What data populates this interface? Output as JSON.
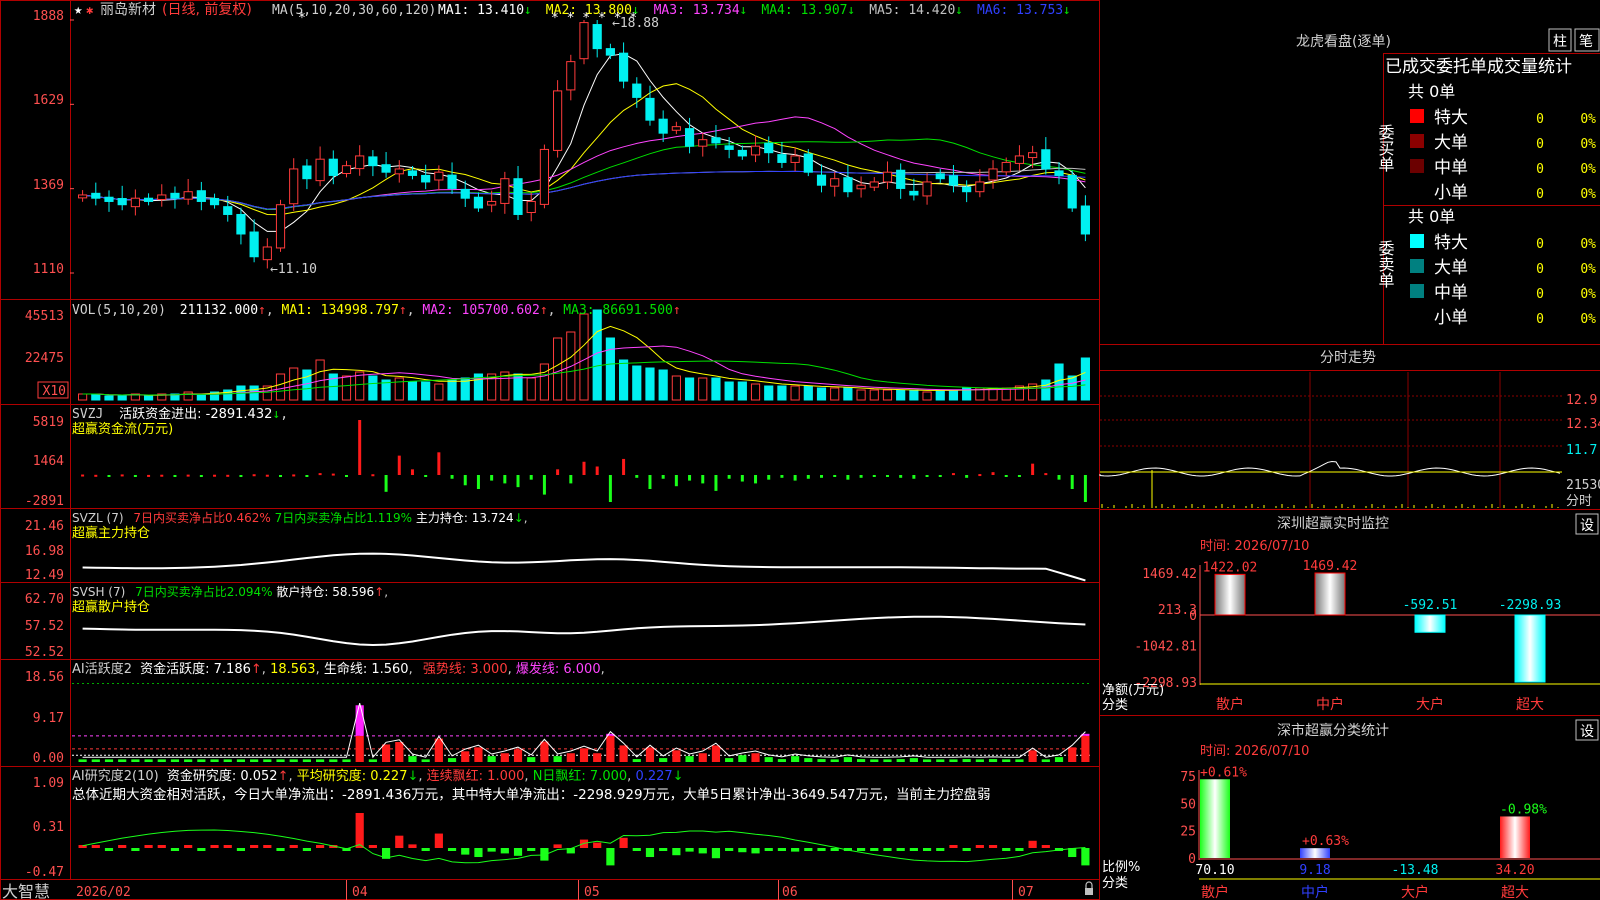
{
  "colors": {
    "up": "#ff3b3b",
    "down": "#00f0f0",
    "grid": "#8b0000",
    "axis": "#ff5050",
    "bg": "#000000",
    "white": "#ffffff",
    "yellow": "#ffff00",
    "magenta": "#ff44ff",
    "green": "#00e000",
    "blue": "#3040ff"
  },
  "header": {
    "stock": "丽岛新材",
    "mode": "(日线, 前复权)",
    "ma_spec": "MA(5,10,20,30,60,120)",
    "ma_items": [
      {
        "label": "MA1: 13.410",
        "color": "#ffffff"
      },
      {
        "label": "MA2: 13.800",
        "color": "#ffff00"
      },
      {
        "label": "MA3: 13.734",
        "color": "#ff44ff"
      },
      {
        "label": "MA4: 13.907",
        "color": "#00e000"
      },
      {
        "label": "MA5: 14.420",
        "color": "#c0c0c0"
      },
      {
        "label": "MA6: 13.753",
        "color": "#3040ff"
      }
    ]
  },
  "kline": {
    "y_ticks": [
      "1888",
      "1629",
      "1369",
      "1110"
    ],
    "high_label": "18.88",
    "low_label": "11.10"
  },
  "vol": {
    "title": "VOL(5,10,20)",
    "value": "211132.000",
    "ma1": "MA1: 134998.797",
    "ma2": "MA2: 105700.602",
    "ma3": "MA3: 86691.500",
    "y_ticks": [
      "45513",
      "22475"
    ],
    "unit": "X10"
  },
  "svzj": {
    "title": "SVZJ",
    "label": "活跃资金进出: -2891.432",
    "sub": "超赢资金流(万元)",
    "y_ticks": [
      "5819",
      "1464",
      "-2891"
    ]
  },
  "svzl": {
    "title": "SVZL (7)",
    "a": "7日内买卖净占比0.462%",
    "b": "7日内买卖净占比1.119%",
    "c": "主力持仓: 13.724",
    "sub": "超赢主力持仓",
    "y_ticks": [
      "21.46",
      "16.98",
      "12.49"
    ]
  },
  "svsh": {
    "title": "SVSH (7)",
    "a": "7日内买卖净占比2.094%",
    "b": "散户持仓: 58.596",
    "sub": "超赢散户持仓",
    "y_ticks": [
      "62.70",
      "57.52",
      "52.52"
    ]
  },
  "ai1": {
    "title": "AI活跃度2",
    "a": "资金活跃度: 7.186",
    "b": "18.563",
    "c": "生命线: 1.560",
    "d": "强势线: 3.000",
    "e": "爆发线: 6.000",
    "y_ticks": [
      "18.56",
      "9.17",
      "0.00"
    ]
  },
  "ai2": {
    "title": "AI研究度2(10)",
    "a": "资金研究度: 0.052",
    "b": "平均研究度: 0.227",
    "c": "连续飘红: 1.000",
    "d": "N日飘红: 7.000",
    "e": "0.227",
    "summary": "总体近期大资金相对活跃，今日大单净流出：-2891.436万元，其中特大单净流出：-2298.929万元，大单5日累计净出-3649.547万元，当前主力控盘弱",
    "y_ticks": [
      "1.09",
      "0.31",
      "-0.47"
    ]
  },
  "footer": {
    "brand": "大智慧",
    "dates": [
      "2026/02",
      "04",
      "05",
      "06",
      "07"
    ]
  },
  "dragon": {
    "title": "龙虎看盘(逐单)",
    "btn1": "柱",
    "btn2": "笔",
    "header": "已成交委托单成交量统计",
    "buy": {
      "side": "委买单",
      "total": "共 0单",
      "rows": [
        {
          "name": "特大",
          "v": "0",
          "p": "0%",
          "c": "#ff0000"
        },
        {
          "name": "大单",
          "v": "0",
          "p": "0%",
          "c": "#8b0000"
        },
        {
          "name": "中单",
          "v": "0",
          "p": "0%",
          "c": "#6b0000"
        },
        {
          "name": "小单",
          "v": "0",
          "p": "0%",
          "c": "#000000"
        }
      ]
    },
    "sell": {
      "side": "委卖单",
      "total": "共 0单",
      "rows": [
        {
          "name": "特大",
          "v": "0",
          "p": "0%",
          "c": "#00ffff"
        },
        {
          "name": "大单",
          "v": "0",
          "p": "0%",
          "c": "#008080"
        },
        {
          "name": "中单",
          "v": "0",
          "p": "0%",
          "c": "#008080"
        },
        {
          "name": "小单",
          "v": "0",
          "p": "0%",
          "c": "#000000"
        }
      ]
    }
  },
  "fenshi": {
    "title": "分时走势",
    "y_ticks": [
      "12.9",
      "12.34",
      "11.7",
      "21530",
      "分时"
    ]
  },
  "sz_monitor": {
    "title": "深圳超赢实时监控",
    "btn": "设",
    "time": "时间: 2026/07/10",
    "y_ticks": [
      "1469.42",
      "213.3",
      "0",
      "-1042.81",
      "-2298.93"
    ],
    "ylabel": "净额(万元)",
    "xlabel": "分类",
    "categories": [
      "散户",
      "中户",
      "大户",
      "超大"
    ],
    "values": [
      "1422.02",
      "1469.42",
      "-592.51",
      "-2298.93"
    ]
  },
  "sz_class": {
    "title": "深市超赢分类统计",
    "btn": "设",
    "time": "时间: 2026/07/10",
    "y_ticks": [
      "75",
      "50",
      "25",
      "0"
    ],
    "ylabel": "比例%",
    "xlabel": "分类",
    "categories": [
      "散户",
      "中户",
      "大户",
      "超大"
    ],
    "top_labels": [
      "+0.61%",
      "+0.63%",
      "",
      "-0.98%"
    ],
    "values": [
      "70.10",
      "9.18",
      "-13.48",
      "34.20"
    ]
  },
  "chart_data": [
    {
      "type": "candlestick",
      "title": "丽岛新材 (日线, 前复权)",
      "ylim": [
        11.1,
        18.88
      ],
      "x_labels": [
        "2026/02",
        "04",
        "05",
        "06",
        "07"
      ],
      "close": [
        13.5,
        13.4,
        13.3,
        13.2,
        13.4,
        13.3,
        13.5,
        13.4,
        13.6,
        13.3,
        13.2,
        12.9,
        12.3,
        11.6,
        11.9,
        13.2,
        14.3,
        14.0,
        14.6,
        14.1,
        14.4,
        14.7,
        14.4,
        14.2,
        14.3,
        14.1,
        13.9,
        14.2,
        13.7,
        13.4,
        13.1,
        13.3,
        14.0,
        12.9,
        13.3,
        14.9,
        16.7,
        17.6,
        18.8,
        18.0,
        17.8,
        17.0,
        16.5,
        15.8,
        15.4,
        15.6,
        15.0,
        15.2,
        15.1,
        14.9,
        14.7,
        15.0,
        14.8,
        14.5,
        14.7,
        14.2,
        13.8,
        14.0,
        13.6,
        13.8,
        13.9,
        14.2,
        13.7,
        13.5,
        13.9,
        14.0,
        13.8,
        13.6,
        13.9,
        14.3,
        14.5,
        14.7,
        14.8,
        14.3,
        14.1,
        13.1,
        12.3
      ],
      "ma5_last": 13.41,
      "ma10_last": 13.8,
      "ma20_last": 13.734,
      "ma30_last": 13.907,
      "ma60_last": 14.42,
      "ma120_last": 13.753
    },
    {
      "type": "bar",
      "title": "VOL(5,10,20)",
      "ylim": [
        0,
        45513
      ],
      "values_x10": [
        3,
        3,
        2,
        2,
        3,
        2,
        3,
        3,
        4,
        3,
        4,
        5,
        7,
        7,
        7,
        13,
        16,
        15,
        20,
        13,
        12,
        14,
        12,
        10,
        11,
        9,
        9,
        8,
        10,
        11,
        13,
        13,
        14,
        13,
        11,
        18,
        31,
        34,
        43,
        45,
        31,
        20,
        17,
        16,
        15,
        12,
        11,
        11,
        11,
        9,
        9,
        8,
        7,
        7,
        7,
        7,
        6,
        6,
        6,
        5,
        5,
        5,
        5,
        5,
        4,
        5,
        5,
        6,
        6,
        6,
        6,
        7,
        8,
        10,
        18,
        12,
        21
      ]
    },
    {
      "type": "bar",
      "title": "超赢资金流(万元)",
      "ylim": [
        -2891,
        5819
      ],
      "values": [
        50,
        20,
        -30,
        60,
        -40,
        10,
        30,
        -20,
        40,
        -50,
        30,
        20,
        -60,
        80,
        30,
        -10,
        60,
        -120,
        200,
        150,
        -30,
        5819,
        80,
        -1800,
        2050,
        600,
        -200,
        2400,
        -400,
        -1100,
        -1500,
        -600,
        -900,
        -1300,
        -500,
        -2100,
        600,
        -900,
        1400,
        900,
        -2891,
        1700,
        -300,
        -1500,
        -400,
        -1200,
        -600,
        -900,
        -1700,
        -400,
        -700,
        -900,
        -500,
        -300,
        -600,
        -400,
        -300,
        -200,
        -500,
        -300,
        -200,
        -100,
        -300,
        -400,
        -200,
        -100,
        200,
        -300,
        100,
        300,
        -200,
        -100,
        1200,
        200,
        -500,
        -1500,
        -2891
      ]
    },
    {
      "type": "line",
      "title": "超赢主力持仓",
      "ylim": [
        12.49,
        21.46
      ],
      "last": 13.724
    },
    {
      "type": "line",
      "title": "超赢散户持仓",
      "ylim": [
        52.52,
        62.7
      ],
      "last": 58.596
    },
    {
      "type": "bar",
      "title": "AI活跃度2",
      "ylim": [
        0,
        18.56
      ],
      "last": 7.186,
      "life_line": 1.56,
      "strong_line": 3.0,
      "burst_line": 6.0
    },
    {
      "type": "bar",
      "title": "AI研究度2(10)",
      "ylim": [
        -0.47,
        1.09
      ],
      "last": 0.052,
      "avg": 0.227
    },
    {
      "type": "bar",
      "title": "深圳超赢实时监控",
      "categories": [
        "散户",
        "中户",
        "大户",
        "超大"
      ],
      "values": [
        1422.02,
        1469.42,
        -592.51,
        -2298.93
      ],
      "ylabel": "净额(万元)"
    },
    {
      "type": "bar",
      "title": "深市超赢分类统计",
      "categories": [
        "散户",
        "中户",
        "大户",
        "超大"
      ],
      "values": [
        70.1,
        9.18,
        -13.48,
        34.2
      ],
      "ylabel": "比例%",
      "ylim": [
        0,
        75
      ]
    }
  ]
}
